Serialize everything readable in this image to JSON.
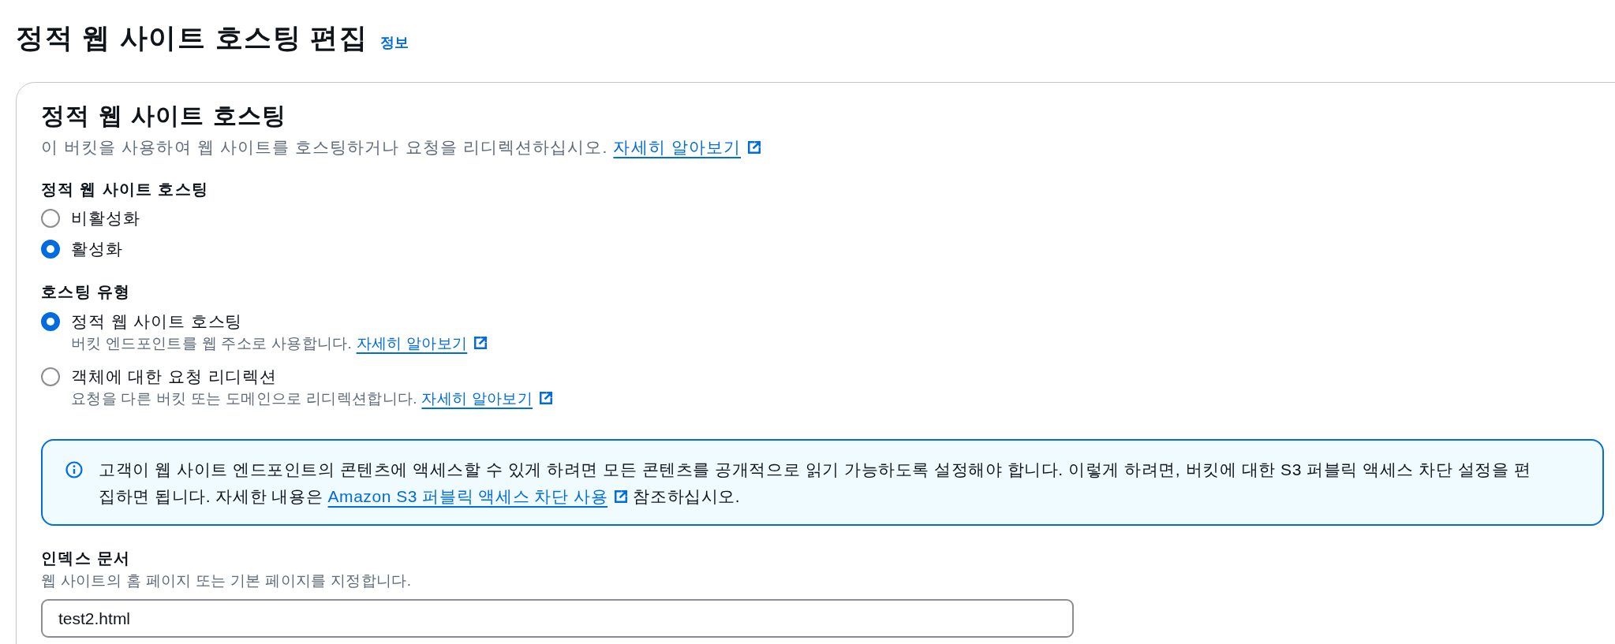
{
  "page": {
    "title": "정적 웹 사이트 호스팅 편집",
    "info_link": "정보"
  },
  "panel": {
    "title": "정적 웹 사이트 호스팅",
    "description": {
      "text": "이 버킷을 사용하여 웹 사이트를 호스팅하거나 요청을 리디렉션하십시오.",
      "link": "자세히 알아보기"
    }
  },
  "hosting": {
    "label": "정적 웹 사이트 호스팅",
    "options": [
      {
        "label": "비활성화",
        "selected": false
      },
      {
        "label": "활성화",
        "selected": true
      }
    ]
  },
  "hosting_type": {
    "label": "호스팅 유형",
    "options": [
      {
        "label": "정적 웹 사이트 호스팅",
        "description": "버킷 엔드포인트를 웹 주소로 사용합니다.",
        "link": "자세히 알아보기",
        "selected": true
      },
      {
        "label": "객체에 대한 요청 리디렉션",
        "description": "요청을 다른 버킷 또는 도메인으로 리디렉션합니다.",
        "link": "자세히 알아보기",
        "selected": false
      }
    ]
  },
  "alert": {
    "text_before": "고객이 웹 사이트 엔드포인트의 콘텐츠에 액세스할 수 있게 하려면 모든 콘텐츠를 공개적으로 읽기 가능하도록 설정해야 합니다. 이렇게 하려면, 버킷에 대한 S3 퍼블릭 액세스 차단 설정을 편집하면 됩니다. 자세한 내용은",
    "link": "Amazon S3 퍼블릭 액세스 차단 사용",
    "text_after": "참조하십시오."
  },
  "index_document": {
    "label": "인덱스 문서",
    "description": "웹 사이트의 홈 페이지 또는 기본 페이지를 지정합니다.",
    "value": "test2.html"
  }
}
